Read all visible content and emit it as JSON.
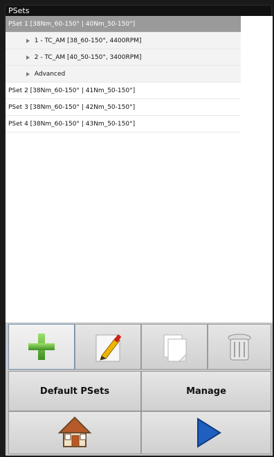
{
  "panel": {
    "title": "PSets"
  },
  "psets": [
    {
      "label": "PSet 1 [38Nm_60-150° | 40Nm_50-150°]",
      "selected": true
    },
    {
      "label": "1 - TC_AM [38_60-150°, 4400RPM]",
      "sub": true
    },
    {
      "label": "2 - TC_AM [40_50-150°, 3400RPM]",
      "sub": true
    },
    {
      "label": "Advanced",
      "sub": true
    },
    {
      "label": "PSet 2 [38Nm_60-150° | 41Nm_50-150°]"
    },
    {
      "label": "PSet 3 [38Nm_60-150° | 42Nm_50-150°]"
    },
    {
      "label": "PSet 4 [38Nm_60-150° | 43Nm_50-150°]"
    }
  ],
  "toolbar": {
    "icons": [
      "plus-icon",
      "pencil-icon",
      "copy-icon",
      "trash-icon"
    ]
  },
  "actions": {
    "default_psets": "Default PSets",
    "manage": "Manage"
  },
  "nav": {
    "icons": [
      "home-icon",
      "play-icon"
    ]
  }
}
